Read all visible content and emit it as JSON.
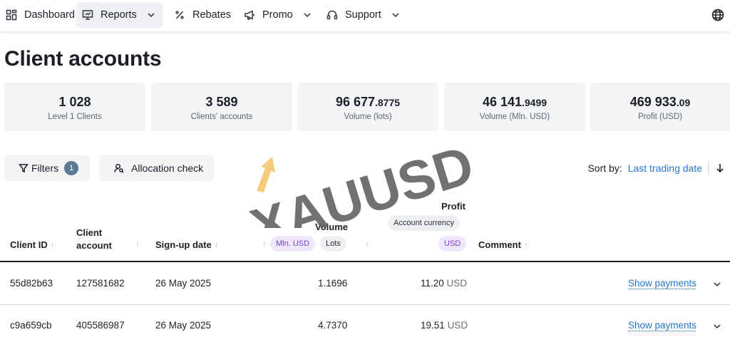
{
  "nav": {
    "items": [
      {
        "label": "Dashboard",
        "icon": "dashboard-icon"
      },
      {
        "label": "Reports",
        "icon": "reports-icon",
        "dropdown": true,
        "active": true
      },
      {
        "label": "Rebates",
        "icon": "percent-icon"
      },
      {
        "label": "Promo",
        "icon": "megaphone-icon",
        "dropdown": true
      },
      {
        "label": "Support",
        "icon": "headset-icon",
        "dropdown": true
      }
    ],
    "language_icon": "globe-icon"
  },
  "page_title": "Client accounts",
  "stats": [
    {
      "value_int": "1 028",
      "value_dec": "",
      "label": "Level 1 Clients"
    },
    {
      "value_int": "3 589",
      "value_dec": "",
      "label": "Clients' accounts"
    },
    {
      "value_int": "96 677",
      "value_dec": ".8775",
      "label": "Volume (lots)"
    },
    {
      "value_int": "46 141",
      "value_dec": ".9499",
      "label": "Volume (Mln. USD)"
    },
    {
      "value_int": "469 933",
      "value_dec": ".09",
      "label": "Profit (USD)"
    }
  ],
  "toolbar": {
    "filters_label": "Filters",
    "filters_count": "1",
    "allocation_label": "Allocation check",
    "sort_label": "Sort by:",
    "sort_value": "Last trading date"
  },
  "table": {
    "headers": {
      "client_id": "Client ID",
      "client_account": "Client account",
      "signup_date": "Sign-up date",
      "volume": "Volume",
      "volume_mln": "Mln. USD",
      "volume_lots": "Lots",
      "profit": "Profit",
      "profit_currency": "Account currency",
      "profit_usd": "USD",
      "comment": "Comment"
    },
    "rows": [
      {
        "client_id": "55d82b63",
        "account": "127581682",
        "signup": "26 May 2025",
        "volume": "1.1696",
        "profit": "11.20",
        "currency": "USD",
        "action": "Show payments"
      },
      {
        "client_id": "c9a659cb",
        "account": "405586987",
        "signup": "26 May 2025",
        "volume": "4.7370",
        "profit": "19.51",
        "currency": "USD",
        "action": "Show payments"
      }
    ]
  },
  "watermark": {
    "text": "XAUUSD",
    "color": "#5e5e5e",
    "arrow_color": "#f2c76e"
  }
}
